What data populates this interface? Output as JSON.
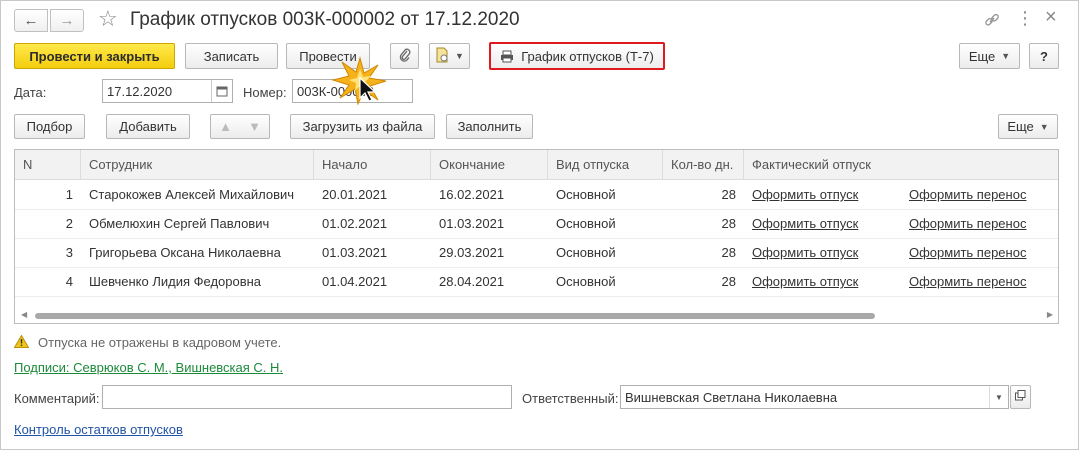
{
  "window": {
    "title": "График отпусков 003К-000002 от 17.12.2020",
    "nav_back": "←",
    "nav_forward": "→",
    "star": "☆",
    "link_icon": "link-icon",
    "menu_icon": "⋮",
    "close_icon": "×"
  },
  "toolbar": {
    "post_and_close": "Провести и закрыть",
    "save": "Записать",
    "post": "Провести",
    "print_t7": "График отпусков (Т-7)",
    "more": "Еще",
    "help": "?"
  },
  "header_fields": {
    "date_label": "Дата:",
    "date_value": "17.12.2020",
    "number_label": "Номер:",
    "number_value": "003К-000002"
  },
  "table_toolbar": {
    "select": "Подбор",
    "add": "Добавить",
    "load_from_file": "Загрузить из файла",
    "fill": "Заполнить",
    "more": "Еще"
  },
  "table": {
    "columns": [
      "N",
      "Сотрудник",
      "Начало",
      "Окончание",
      "Вид отпуска",
      "Кол-во дн.",
      "Фактический отпуск"
    ],
    "rows": [
      {
        "n": "1",
        "employee": "Старокожев Алексей Михайлович",
        "start": "20.01.2021",
        "end": "16.02.2021",
        "type": "Основной",
        "days": "28",
        "action1": "Оформить отпуск",
        "action2": "Оформить перенос"
      },
      {
        "n": "2",
        "employee": "Обмелюхин Сергей Павлович",
        "start": "01.02.2021",
        "end": "01.03.2021",
        "type": "Основной",
        "days": "28",
        "action1": "Оформить отпуск",
        "action2": "Оформить перенос"
      },
      {
        "n": "3",
        "employee": "Григорьева Оксана Николаевна",
        "start": "01.03.2021",
        "end": "29.03.2021",
        "type": "Основной",
        "days": "28",
        "action1": "Оформить отпуск",
        "action2": "Оформить перенос"
      },
      {
        "n": "4",
        "employee": "Шевченко Лидия Федоровна",
        "start": "01.04.2021",
        "end": "28.04.2021",
        "type": "Основной",
        "days": "28",
        "action1": "Оформить отпуск",
        "action2": "Оформить перенос"
      }
    ]
  },
  "footer": {
    "warning": "Отпуска не отражены в кадровом учете.",
    "signatures": "Подписи: Севрюков С. М., Вишневская С. Н.",
    "comment_label": "Комментарий:",
    "comment_value": "",
    "responsible_label": "Ответственный:",
    "responsible_value": "Вишневская Светлана Николаевна",
    "balance_link": "Контроль остатков отпусков"
  },
  "colors": {
    "primary_button": "#f4cd0e",
    "highlight_border": "#e0191f",
    "signature_link": "#1c8a3a",
    "balance_link": "#2153a6",
    "warning_icon": "#f0c419"
  }
}
